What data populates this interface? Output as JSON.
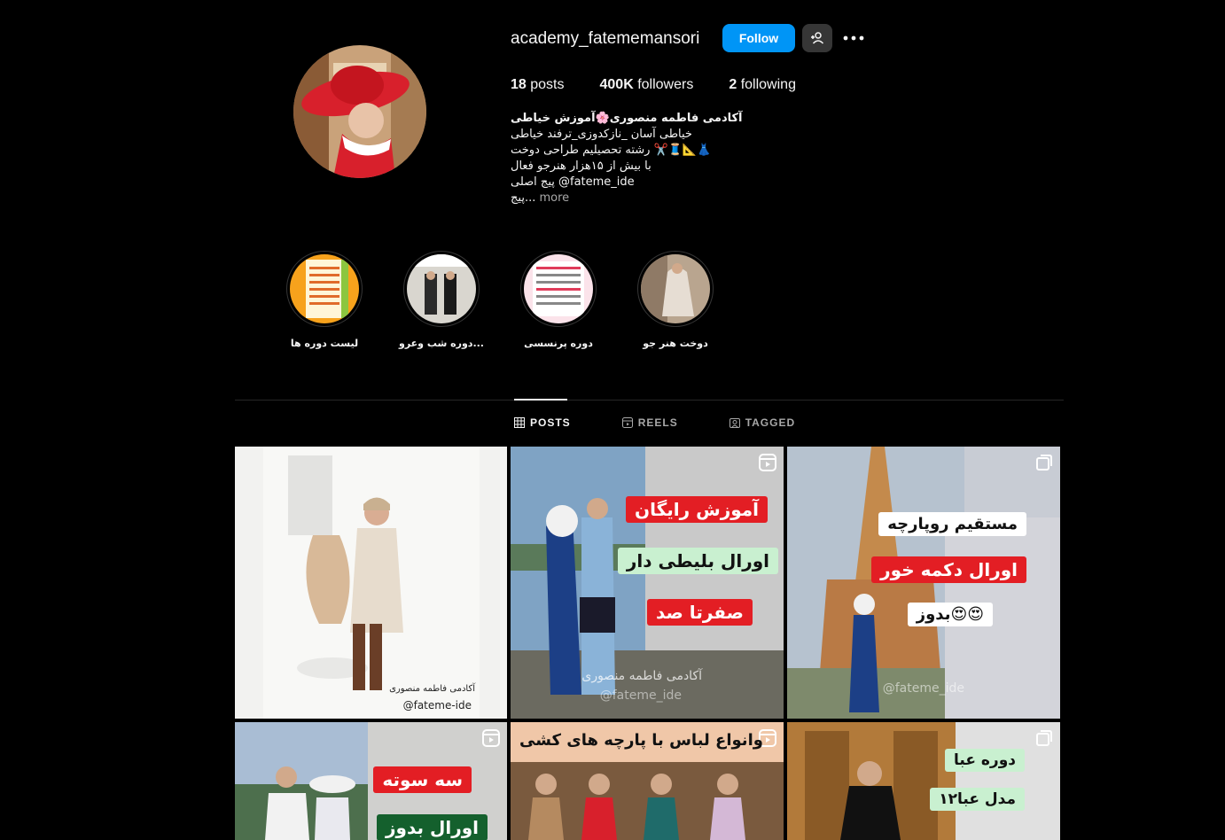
{
  "profile": {
    "username": "academy_fatememansori",
    "follow_label": "Follow",
    "stats": {
      "posts_count": "18",
      "posts_label": "posts",
      "followers_count": "400K",
      "followers_label": "followers",
      "following_count": "2",
      "following_label": "following"
    },
    "bio": {
      "name": "آکادمی فاطمه منصوری🌸آموزش خیاطی",
      "line1": "خیاطی آسان _نازکدوزی_ترفند خیاطی",
      "line2": "رشته تحصیلیم طراحی دوخت ✂️🧵📐👗",
      "line3": "با بیش از ۱۵هزار هنرجو فعال",
      "line4": "پیج اصلی @fateme_ide",
      "line5_text": "پیج...",
      "more_label": "more"
    }
  },
  "highlights": [
    {
      "label": "لیست دوره ها",
      "icon": "course-list-thumbnail"
    },
    {
      "label": "دوره شب وعرو...",
      "icon": "evening-dress-thumbnail"
    },
    {
      "label": "دوره پرنسسی",
      "icon": "princess-course-thumbnail"
    },
    {
      "label": "دوخت هنر جو",
      "icon": "student-sewing-thumbnail"
    }
  ],
  "tabs": [
    {
      "label": "POSTS",
      "icon": "grid-icon",
      "active": true
    },
    {
      "label": "REELS",
      "icon": "reels-icon",
      "active": false
    },
    {
      "label": "TAGGED",
      "icon": "tagged-icon",
      "active": false
    }
  ],
  "posts": {
    "p1": {
      "watermark1": "آکادمی فاطمه منصوری",
      "watermark2": "@fateme-ide"
    },
    "p2": {
      "o1": "آموزش رایگان",
      "o2": "اورال بلیطی دار",
      "o3": "صفرتا صد",
      "watermark1": "آکادمی فاطمه منصوری",
      "watermark2": "@fateme_ide",
      "type": "reel-icon"
    },
    "p3": {
      "o1": "مستقیم روپارچه",
      "o2": "اورال دکمه خور",
      "o3": "بدوز😍😍",
      "watermark": "@fateme_ide",
      "type": "carousel-icon"
    },
    "p4": {
      "o1": "سه سوته",
      "o2": "اورال بدوز",
      "type": "reel-icon"
    },
    "p5": {
      "o1": "وانواع لباس با پارچه های کشی",
      "type": "reel-icon"
    },
    "p6": {
      "o1": "دوره عبا",
      "o2": "۱۲مدل عبا",
      "type": "carousel-icon"
    }
  },
  "colors": {
    "accent": "#0095f6",
    "background": "#000000",
    "secondary_button": "#363636"
  }
}
